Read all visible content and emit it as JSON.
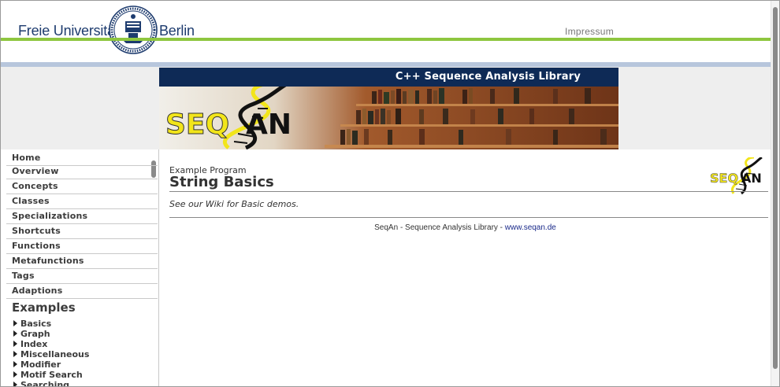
{
  "header": {
    "brand_left": "Freie Universität",
    "brand_right": "Berlin",
    "impressum": "Impressum"
  },
  "banner": {
    "title": "C++ Sequence Analysis Library",
    "logo_text": "SEQAN"
  },
  "sidebar": {
    "items": [
      {
        "label": "Home"
      },
      {
        "label": "Overview"
      },
      {
        "label": "Concepts"
      },
      {
        "label": "Classes"
      },
      {
        "label": "Specializations"
      },
      {
        "label": "Shortcuts"
      },
      {
        "label": "Functions"
      },
      {
        "label": "Metafunctions"
      },
      {
        "label": "Tags"
      },
      {
        "label": "Adaptions"
      }
    ],
    "examples_heading": "Examples",
    "examples": [
      {
        "label": "Basics"
      },
      {
        "label": "Graph"
      },
      {
        "label": "Index"
      },
      {
        "label": "Miscellaneous"
      },
      {
        "label": "Modifier"
      },
      {
        "label": "Motif Search"
      },
      {
        "label": "Searching"
      }
    ]
  },
  "main": {
    "breadcrumb": "Example Program",
    "title": "String Basics",
    "note_prefix": "See our ",
    "note_link": "Wiki",
    "note_suffix": " for Basic demos.",
    "footer_text": "SeqAn - Sequence Analysis Library - ",
    "footer_link": "www.seqan.de"
  },
  "colors": {
    "fu_blue": "#1d3b6e",
    "green_line": "#8ec63f",
    "banner_navy": "#0e2a56",
    "logo_yellow": "#f2e51a"
  }
}
